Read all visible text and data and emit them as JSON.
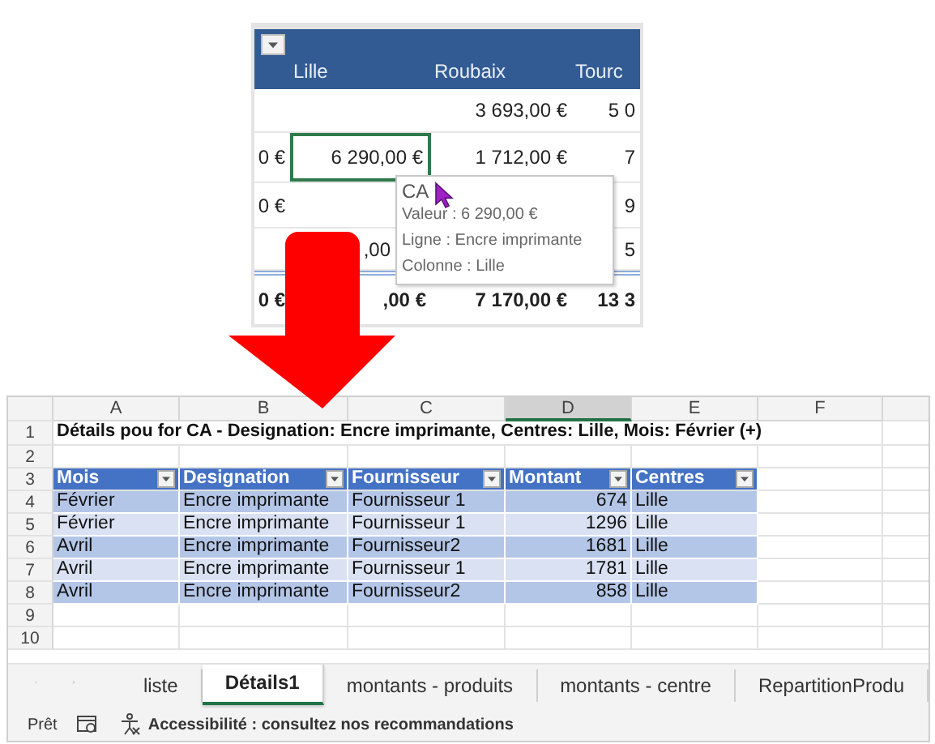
{
  "pivot": {
    "headers": [
      "Lille",
      "Roubaix",
      "Tourc"
    ],
    "rows": [
      {
        "cells": [
          {
            "selected": false
          },
          {
            "selected": false
          },
          {
            "text": "3 693,00 €",
            "selected": false
          },
          {
            "text": "5 0",
            "selected": false
          }
        ]
      },
      {
        "cells": [
          {
            "text": "0 €",
            "selected": false
          },
          {
            "text": "6 290,00 €",
            "selected": true
          },
          {
            "text": "1 712,00 €",
            "selected": false
          },
          {
            "text": "7",
            "selected": false
          }
        ]
      },
      {
        "cells": [
          {
            "text": "0 €",
            "selected": false
          },
          {
            "selected": false
          },
          null,
          {
            "text": "9",
            "selected": false
          }
        ]
      },
      {
        "cells": [
          {
            "selected": false
          },
          {
            "text": ",00",
            "selected": false,
            "covered": true
          },
          null,
          {
            "text": "5",
            "selected": false
          }
        ]
      }
    ],
    "total": [
      "0 €",
      ",00 €",
      "7 170,00 €",
      "13 3"
    ]
  },
  "tooltip": {
    "title": "CA",
    "lines": [
      "Valeur : 6 290,00 €",
      "Ligne : Encre imprimante",
      "Colonne : Lille"
    ]
  },
  "sheet": {
    "columns": [
      {
        "label": "A",
        "selected": false
      },
      {
        "label": "B",
        "selected": false
      },
      {
        "label": "C",
        "selected": false
      },
      {
        "label": "D",
        "selected": true
      },
      {
        "label": "E",
        "selected": false
      },
      {
        "label": "F",
        "selected": false
      }
    ],
    "row_numbers": [
      "1",
      "2",
      "3",
      "4",
      "5",
      "6",
      "7",
      "8",
      "9",
      "10"
    ],
    "title": "Détails pou for CA - Designation: Encre imprimante, Centres: Lille, Mois: Février (+)",
    "table": {
      "columns": [
        {
          "label": "Mois",
          "numeric": false
        },
        {
          "label": "Designation",
          "numeric": false
        },
        {
          "label": "Fournisseur",
          "numeric": false
        },
        {
          "label": "Montant",
          "numeric": true
        },
        {
          "label": "Centres",
          "numeric": false
        }
      ],
      "rows": [
        [
          "Février",
          "Encre imprimante",
          "Fournisseur 1",
          "674",
          "Lille"
        ],
        [
          "Février",
          "Encre imprimante",
          "Fournisseur 1",
          "1296",
          "Lille"
        ],
        [
          "Avril",
          "Encre imprimante",
          "Fournisseur2",
          "1681",
          "Lille"
        ],
        [
          "Avril",
          "Encre imprimante",
          "Fournisseur 1",
          "1781",
          "Lille"
        ],
        [
          "Avril",
          "Encre imprimante",
          "Fournisseur2",
          "858",
          "Lille"
        ]
      ]
    }
  },
  "sheet_tabs": [
    {
      "label": "liste",
      "selected": false
    },
    {
      "label": "Détails1",
      "selected": true
    },
    {
      "label": "montants - produits",
      "selected": false
    },
    {
      "label": "montants - centre",
      "selected": false
    },
    {
      "label": "RepartitionProdu",
      "selected": false
    }
  ],
  "status_bar": {
    "mode": "Prêt",
    "accessibility": "Accessibilité : consultez nos recommandations"
  }
}
